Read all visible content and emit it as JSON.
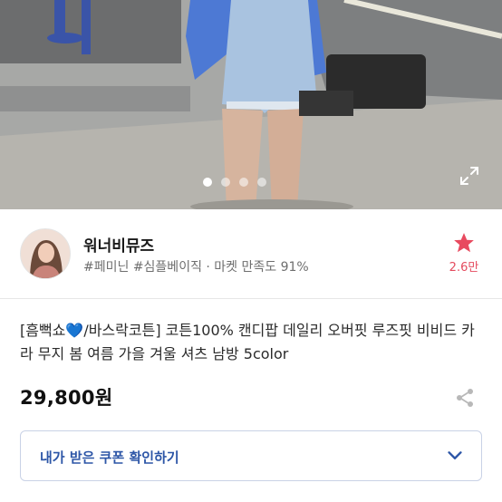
{
  "gallery": {
    "slides": 4,
    "current": 1
  },
  "seller": {
    "name": "워너비뮤즈",
    "tags": "#페미닌 #심플베이직 · 마켓 만족도 91%",
    "favorite_count": "2.6만"
  },
  "product": {
    "title": "[흠뻑쇼💙/바스락코튼] 코튼100% 캔디팝 데일리 오버핏 루즈핏 비비드 카라 무지 봄 여름 가을 겨울 셔츠 남방 5color",
    "price": "29,800원"
  },
  "coupon": {
    "label": "내가 받은 쿠폰 확인하기"
  },
  "colors": {
    "accent_star": "#e84a5f",
    "coupon_text": "#2d56a7",
    "coupon_border": "#c9d2e6"
  },
  "icons": {
    "expand": "expand-icon",
    "favorite": "star-icon",
    "share": "share-icon",
    "chevron": "chevron-down-icon"
  }
}
